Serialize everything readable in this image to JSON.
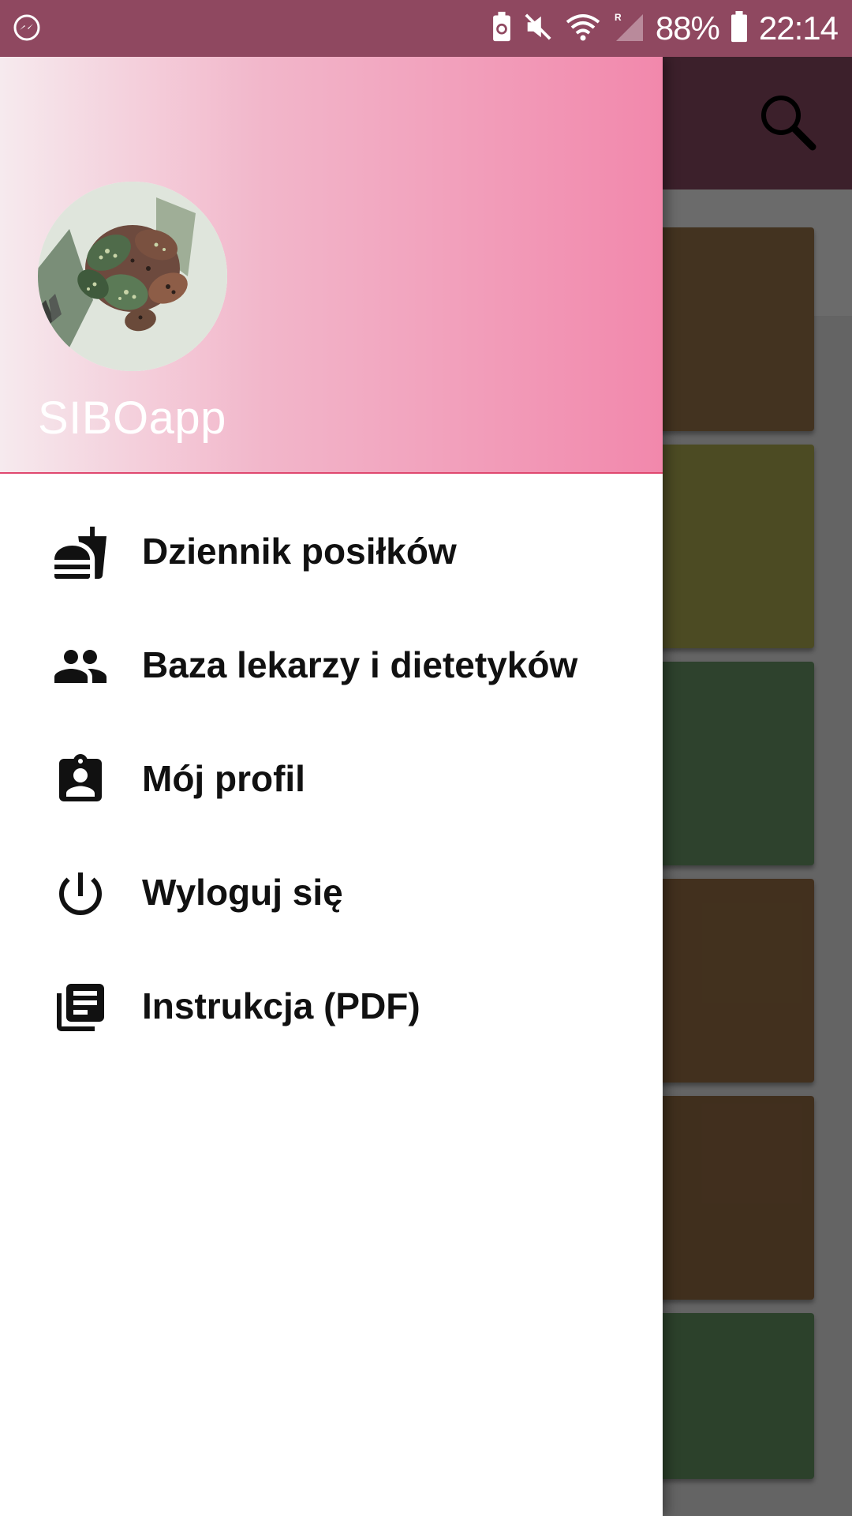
{
  "status_bar": {
    "left_icon": "messenger-icon",
    "right_icons": [
      "battery-saver-icon",
      "mute-icon",
      "wifi-icon",
      "signal-roaming-icon",
      "battery-icon"
    ],
    "battery_percent": "88%",
    "time": "22:14"
  },
  "background_app": {
    "search_icon": "search-icon",
    "card_colors": [
      "#a17a4d",
      "#b6b353",
      "#6e9e6c",
      "#9e7448",
      "#9a7147",
      "#6a9c68"
    ]
  },
  "drawer": {
    "header": {
      "avatar": "plant-photo-avatar",
      "app_name": "SIBOapp",
      "gradient_colors": [
        "#f6eaee",
        "#f288ac"
      ]
    },
    "menu_items": [
      {
        "icon": "fastfood-icon",
        "label": "Dziennik posiłków"
      },
      {
        "icon": "people-icon",
        "label": "Baza lekarzy i dietetyków"
      },
      {
        "icon": "assignment-ind-icon",
        "label": "Mój profil"
      },
      {
        "icon": "power-icon",
        "label": "Wyloguj się"
      },
      {
        "icon": "library-books-icon",
        "label": "Instrukcja (PDF)"
      }
    ]
  },
  "colors": {
    "status_bar": "#8f4860",
    "toolbar": "#8f4d68",
    "accent_line": "#e0486f"
  }
}
